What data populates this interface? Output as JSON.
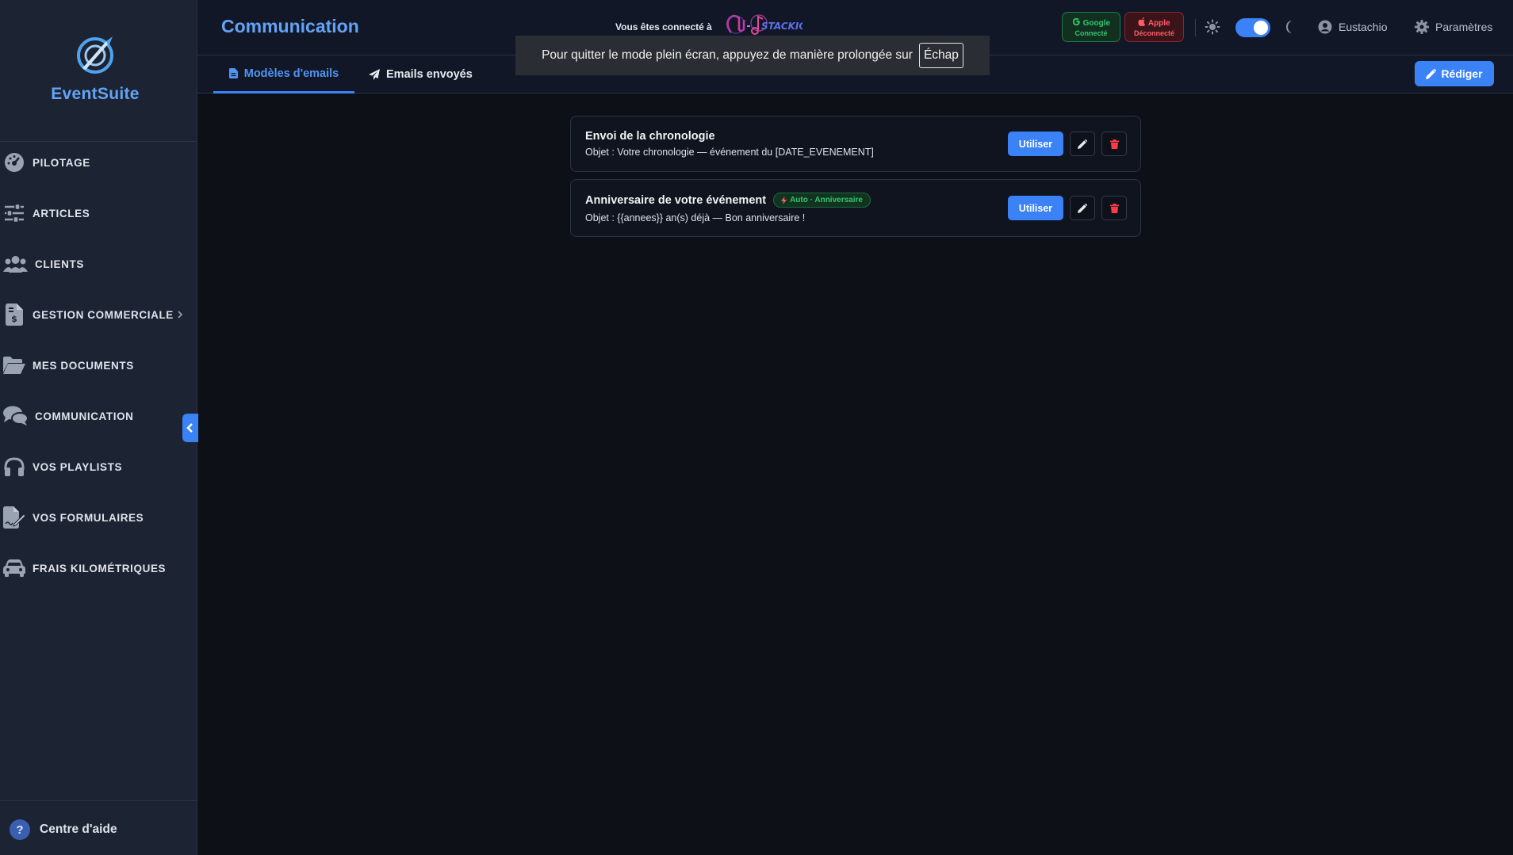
{
  "app": {
    "name": "EventSuite"
  },
  "sidebar": {
    "items": [
      {
        "label": "PILOTAGE",
        "icon": "dashboard-gauge-icon"
      },
      {
        "label": "ARTICLES",
        "icon": "sliders-icon"
      },
      {
        "label": "CLIENTS",
        "icon": "users-icon"
      },
      {
        "label": "GESTION COMMERCIALE",
        "icon": "invoice-dollar-icon"
      },
      {
        "label": "MES DOCUMENTS",
        "icon": "folder-open-icon"
      },
      {
        "label": "COMMUNICATION",
        "icon": "comments-icon"
      },
      {
        "label": "VOS PLAYLISTS",
        "icon": "headphones-icon"
      },
      {
        "label": "VOS FORMULAIRES",
        "icon": "file-signature-icon"
      },
      {
        "label": "FRAIS KILOMÉTRIQUES",
        "icon": "car-icon"
      }
    ],
    "help_label": "Centre d'aide"
  },
  "header": {
    "title": "Communication",
    "connected_text": "Vous êtes connecté à",
    "google": {
      "name": "Google",
      "status": "Connecté"
    },
    "apple": {
      "name": "Apple",
      "status": "Déconnecté"
    },
    "user_name": "Eustachio",
    "settings_label": "Paramètres"
  },
  "tabs": {
    "templates_label": "Modèles d'emails",
    "sent_label": "Emails envoyés",
    "compose_label": "Rédiger"
  },
  "fullscreen_notice": {
    "text": "Pour quitter le mode plein écran, appuyez de manière prolongée sur",
    "key": "Échap"
  },
  "templates": [
    {
      "title": "Envoi de la chronologie",
      "subject": "Objet : Votre chronologie — événement du [DATE_EVENEMENT]",
      "use_label": "Utiliser"
    },
    {
      "title": "Anniversaire de votre événement",
      "badge": "Auto · Anniversaire",
      "subject": "Objet : {{annees}} an(s) déjà — Bon anniversaire !",
      "use_label": "Utiliser"
    }
  ],
  "colors": {
    "accent": "#3b82f6",
    "title": "#62a3f5",
    "success": "#32c46d",
    "danger": "#ff3b4a",
    "sidebar_bg": "#1c2333",
    "page_bg": "#0d1117"
  }
}
